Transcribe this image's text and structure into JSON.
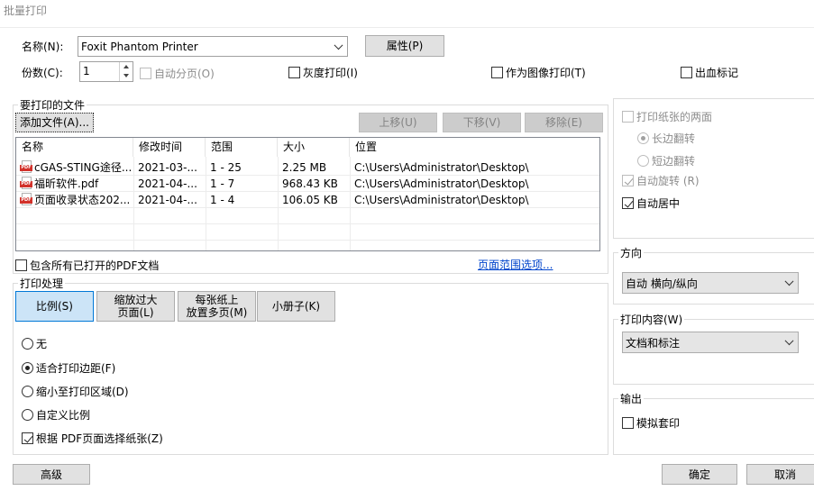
{
  "window": {
    "title": "批量打印"
  },
  "printer": {
    "name_label": "名称(N):",
    "name_value": "Foxit Phantom Printer",
    "properties_button": "属性(P)",
    "copies_label": "份数(C):",
    "copies_value": "1",
    "collate_label": "自动分页(O)",
    "grayscale_label": "灰度打印(I)",
    "as_image_label": "作为图像打印(T)",
    "bleed_label": "出血标记"
  },
  "files": {
    "group_title": "要打印的文件",
    "add_button": "添加文件(A)...",
    "move_up_button": "上移(U)",
    "move_down_button": "下移(V)",
    "remove_button": "移除(E)",
    "columns": [
      "名称",
      "修改时间",
      "范围",
      "大小",
      "位置"
    ],
    "rows": [
      {
        "name": "cGAS-STING途径...",
        "modified": "2021-03-...",
        "range": "1 - 25",
        "size": "2.25 MB",
        "location": "C:\\Users\\Administrator\\Desktop\\"
      },
      {
        "name": "福昕软件.pdf",
        "modified": "2021-04-...",
        "range": "1 - 7",
        "size": "968.43 KB",
        "location": "C:\\Users\\Administrator\\Desktop\\"
      },
      {
        "name": "页面收录状态202...",
        "modified": "2021-04-...",
        "range": "1 - 4",
        "size": "106.05 KB",
        "location": "C:\\Users\\Administrator\\Desktop\\"
      }
    ],
    "include_open_label": "包含所有已打开的PDF文档",
    "page_range_link": "页面范围选项..."
  },
  "print_handling": {
    "group_title": "打印处理",
    "tab_scale": "比例(S)",
    "tab_fit_line1": "缩放过大",
    "tab_fit_line2": "页面(L)",
    "tab_multi_line1": "每张纸上",
    "tab_multi_line2": "放置多页(M)",
    "tab_booklet": "小册子(K)",
    "opt_none": "无",
    "opt_fit_margins": "适合打印边距(F)",
    "opt_shrink": "缩小至打印区域(D)",
    "opt_custom": "自定义比例",
    "choose_paper_label": "根据 PDF页面选择纸张(Z)"
  },
  "duplex": {
    "both_sides_label": "打印纸张的两面",
    "long_edge_label": "长边翻转",
    "short_edge_label": "短边翻转",
    "auto_rotate_label": "自动旋转 (R)",
    "auto_center_label": "自动居中"
  },
  "orientation": {
    "group_title": "方向",
    "value": "自动 横向/纵向"
  },
  "content": {
    "group_title": "打印内容(W)",
    "value": "文档和标注"
  },
  "output": {
    "group_title": "输出",
    "simulate_overprint_label": "模拟套印"
  },
  "footer": {
    "advanced_button": "高级",
    "ok_button": "确定",
    "cancel_button": "取消"
  }
}
